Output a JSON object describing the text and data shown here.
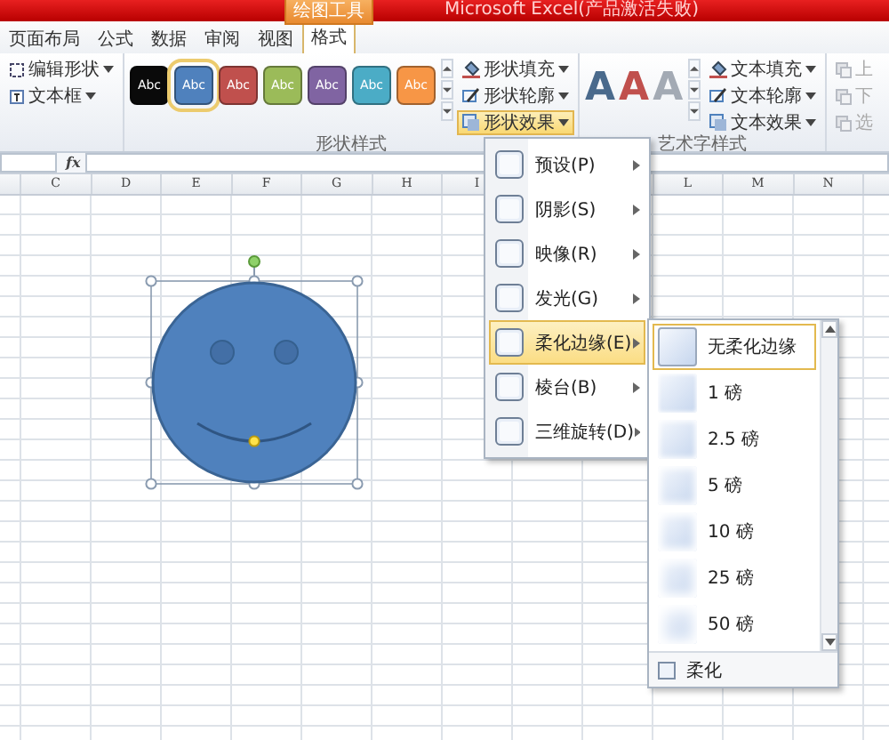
{
  "window": {
    "context_tab": "绘图工具",
    "title": "Microsoft Excel(产品激活失败)"
  },
  "tabs": [
    {
      "label": "页面布局",
      "selected": false
    },
    {
      "label": "公式",
      "selected": false
    },
    {
      "label": "数据",
      "selected": false
    },
    {
      "label": "审阅",
      "selected": false
    },
    {
      "label": "视图",
      "selected": false
    },
    {
      "label": "格式",
      "selected": true
    }
  ],
  "ribbon": {
    "insert_shapes": {
      "items": [
        {
          "label": "编辑形状"
        },
        {
          "label": "文本框"
        }
      ]
    },
    "shape_styles": {
      "label": "形状样式",
      "swatches": [
        {
          "label": "Abc",
          "color": "#0a0a0a",
          "selected": false
        },
        {
          "label": "Abc",
          "color": "#4f81bd",
          "selected": true
        },
        {
          "label": "Abc",
          "color": "#c0504d",
          "selected": false
        },
        {
          "label": "Abc",
          "color": "#9bbb59",
          "selected": false
        },
        {
          "label": "Abc",
          "color": "#8064a2",
          "selected": false
        },
        {
          "label": "Abc",
          "color": "#4bacc6",
          "selected": false
        },
        {
          "label": "Abc",
          "color": "#f79646",
          "selected": false
        }
      ],
      "commands": [
        {
          "label": "形状填充",
          "kind": "fill",
          "selected": false
        },
        {
          "label": "形状轮廓",
          "kind": "outline",
          "selected": false
        },
        {
          "label": "形状效果",
          "kind": "effect",
          "selected": true
        }
      ]
    },
    "wordart_styles": {
      "label": "艺术字样式",
      "letters": [
        {
          "label": "A",
          "color": "#4a6a8c"
        },
        {
          "label": "A",
          "color": "#c0504d"
        },
        {
          "label": "A",
          "color": "#a3aab4"
        }
      ],
      "commands": [
        {
          "label": "文本填充",
          "kind": "fill",
          "selected": false
        },
        {
          "label": "文本轮廓",
          "kind": "outline",
          "selected": false
        },
        {
          "label": "文本效果",
          "kind": "effect",
          "selected": false
        }
      ]
    },
    "arrange": {
      "items": [
        {
          "label": "上",
          "disabled": true
        },
        {
          "label": "下",
          "disabled": true
        },
        {
          "label": "选",
          "disabled": true
        }
      ]
    }
  },
  "formula_bar": {
    "function_label": "fx"
  },
  "columns_left": [
    "C",
    "D",
    "E",
    "F",
    "G",
    "H",
    "I"
  ],
  "columns_right": [
    "L",
    "M",
    "N"
  ],
  "effects_menu": {
    "items": [
      {
        "label": "预设(P)",
        "selected": false,
        "submenu": true
      },
      {
        "label": "阴影(S)",
        "selected": false,
        "submenu": true
      },
      {
        "label": "映像(R)",
        "selected": false,
        "submenu": true
      },
      {
        "label": "发光(G)",
        "selected": false,
        "submenu": true
      },
      {
        "label": "柔化边缘(E)",
        "selected": true,
        "submenu": true
      },
      {
        "label": "棱台(B)",
        "selected": false,
        "submenu": true
      },
      {
        "label": "三维旋转(D)",
        "selected": false,
        "submenu": true
      }
    ]
  },
  "soft_edges_menu": {
    "items": [
      {
        "label": "无柔化边缘",
        "selected": true
      },
      {
        "label": "1 磅",
        "selected": false
      },
      {
        "label": "2.5 磅",
        "selected": false
      },
      {
        "label": "5 磅",
        "selected": false
      },
      {
        "label": "10 磅",
        "selected": false
      },
      {
        "label": "25 磅",
        "selected": false
      },
      {
        "label": "50 磅",
        "selected": false
      }
    ],
    "footer": "柔化"
  }
}
